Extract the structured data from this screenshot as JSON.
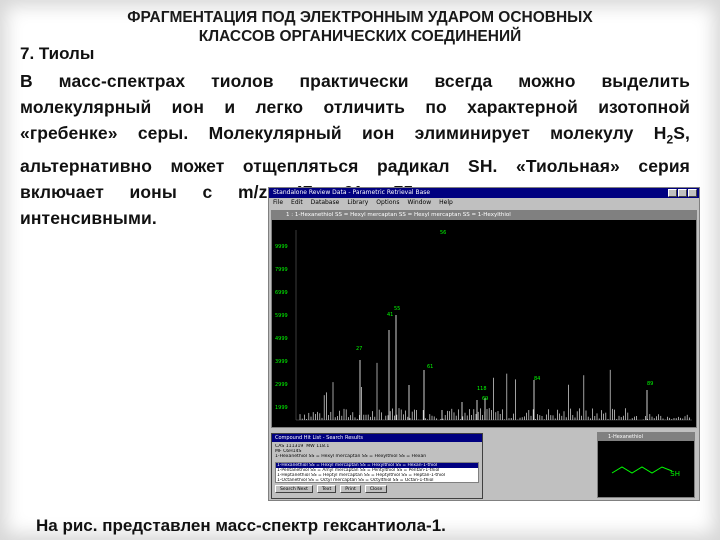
{
  "slide": {
    "title_line1": "ФРАГМЕНТАЦИЯ ПОД ЭЛЕКТРОННЫМ УДАРОМ ОСНОВНЫХ",
    "title_line2": "КЛАССОВ ОРГАНИЧЕСКИХ СОЕДИНЕНИЙ",
    "section": "7. Тиолы",
    "para_lines": [
      "В масс-спектрах тиолов практически всегда можно выделить",
      "молекулярный ион и легко отличить по характерной изотопной",
      "«гребенке» серы. Молекулярный ион элиминирует молекулу H",
      "альтернативно может отщепляться радикал SH. «Тиольная» серия",
      "включает ионы с m/z 47, 61, 75 ..., зачастую не очень",
      "интенсивными."
    ],
    "h2s_sub": "2",
    "h2s_tail": "S,",
    "caption": "На рис. представлен масс-спектр гексантиола-1."
  },
  "window": {
    "title": "Standalone Review Data - Parametric Retrieval Base",
    "menu": [
      "File",
      "Edit",
      "Database",
      "Library",
      "Options",
      "Window",
      "Help"
    ],
    "spectrum_title": "1 : 1-Hexanethiol SS = Hexyl mercaptan SS = Hexyl mercaptan SS = 1-Hexylthiol",
    "y_ticks": [
      "9999",
      "7999",
      "6999",
      "5999",
      "4999",
      "3999",
      "2999",
      "1999"
    ],
    "peak_labels": [
      "56",
      "41",
      "27",
      "55",
      "69",
      "84",
      "89",
      "118",
      "61"
    ],
    "colors": {
      "spectrum_bg": "#000000",
      "peaks": "#e6e6e6",
      "labels": "#00ff00",
      "title_bar": "#000080"
    }
  },
  "dialog": {
    "title": "Compound Hit List - Search Results",
    "cas_label": "CAS",
    "cas_value": "111319",
    "mw_label": "MW",
    "mw_value": "118.1",
    "mf_label": "MF",
    "mf_value": "C6H14S",
    "name": "1-Hexanethiol SS = Hexyl mercaptan SS = Hexylthiol SS = Hexan",
    "list": [
      "1-Hexanethiol SS = Hexyl mercaptan SS = Hexylthiol SS = Hexan-1-thiol",
      "1-Pentanethiol SS = Amyl mercaptan SS = Pentylthiol SS = Pentan-1-thiol",
      "1-Heptanethiol SS = Heptyl mercaptan SS = Heptylthiol SS = Heptan-1-thiol",
      "1-Octanethiol SS = Octyl mercaptan SS = Octylthiol SS = Octan-1-thiol"
    ],
    "buttons": [
      "Search Next",
      "Text",
      "Print",
      "Close"
    ]
  },
  "structure": {
    "title": "1-Hexanethiol",
    "sh_label": "SH"
  }
}
